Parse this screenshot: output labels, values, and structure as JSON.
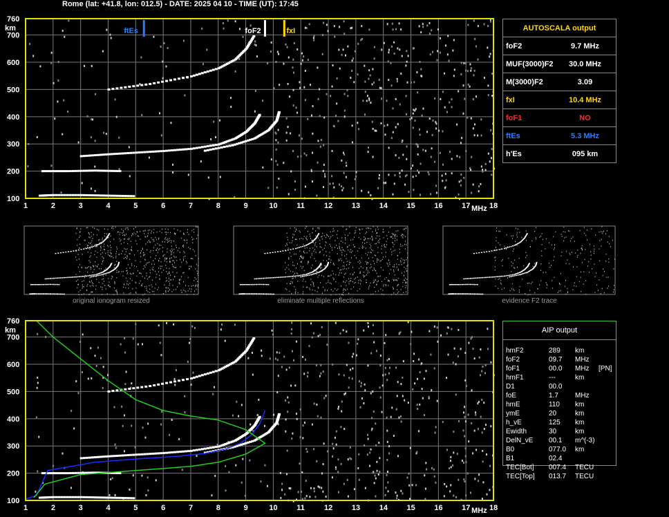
{
  "header": {
    "text": "Rome (lat: +41.8, lon: 012.5) - DATE: 2025 04 10 - TIME (UT): 17:45"
  },
  "colors": {
    "grid": "#7a7a7a",
    "frame": "#e4e000",
    "esblue": "#2a7bff",
    "fxlyellow": "#ffd800",
    "red": "#ff2a2a",
    "green": "#1fd01f",
    "profile": "#1a2cff",
    "panelborder": "#3fbf3f"
  },
  "autoscala": {
    "title": "AUTOSCALA output",
    "rows": [
      {
        "label": "foF2",
        "value": "9.7 MHz",
        "color": "#ffffff"
      },
      {
        "label": "MUF(3000)F2",
        "value": "30.0 MHz",
        "color": "#ffffff"
      },
      {
        "label": "M(3000)F2",
        "value": "3.09",
        "color": "#ffffff"
      },
      {
        "label": "fxI",
        "value": "10.4 MHz",
        "color": "#ffd800"
      },
      {
        "label": "foF1",
        "value": "NO",
        "color": "#ff2a2a"
      },
      {
        "label": "ftEs",
        "value": "5.3 MHz",
        "color": "#2a7bff"
      },
      {
        "label": "h'Es",
        "value": "095     km",
        "color": "#ffffff"
      }
    ]
  },
  "aip": {
    "title": "AIP output",
    "rows": [
      {
        "name": "hmF2",
        "value": "289",
        "unit": "km",
        "extra": ""
      },
      {
        "name": "foF2",
        "value": "09.7",
        "unit": "MHz",
        "extra": ""
      },
      {
        "name": "foF1",
        "value": "00.0",
        "unit": "MHz",
        "extra": "[PN]"
      },
      {
        "name": "hmF1",
        "value": "---",
        "unit": "km",
        "extra": ""
      },
      {
        "name": "D1",
        "value": "00.0",
        "unit": "",
        "extra": ""
      },
      {
        "name": "foE",
        "value": "1.7",
        "unit": "MHz",
        "extra": ""
      },
      {
        "name": "hmE",
        "value": "110",
        "unit": "km",
        "extra": ""
      },
      {
        "name": "ymE",
        "value": "20",
        "unit": "km",
        "extra": ""
      },
      {
        "name": "h_vE",
        "value": "125",
        "unit": "km",
        "extra": ""
      },
      {
        "name": "Ewidth",
        "value": "30",
        "unit": "km",
        "extra": ""
      },
      {
        "name": "DelN_vE",
        "value": "00.1",
        "unit": "m^(-3)",
        "extra": ""
      },
      {
        "name": "B0",
        "value": "077.0",
        "unit": "km",
        "extra": ""
      },
      {
        "name": "B1",
        "value": "02.4",
        "unit": "",
        "extra": ""
      },
      {
        "name": "TEC[Bot]",
        "value": "007.4",
        "unit": "TECU",
        "extra": ""
      },
      {
        "name": "TEC[Top]",
        "value": "013.7",
        "unit": "TECU",
        "extra": ""
      }
    ]
  },
  "captions": [
    "original ionogram resized",
    "eliminate multiple reflections",
    "evidence F2 trace"
  ],
  "chart_data": [
    {
      "type": "scatter",
      "title": "",
      "xlabel": "MHz",
      "ylabel": "km",
      "xlim": [
        1,
        18
      ],
      "ylim": [
        100,
        760
      ],
      "x_ticks": [
        "1",
        "2",
        "3",
        "4",
        "5",
        "6",
        "7",
        "8",
        "9",
        "10",
        "11",
        "12",
        "13",
        "14",
        "15",
        "16",
        "17",
        "18"
      ],
      "y_ticks": [
        "100",
        "200",
        "300",
        "400",
        "500",
        "600",
        "700",
        "760"
      ],
      "markers": [
        {
          "label": "ftEs",
          "freq": 5.3,
          "color": "#2a7bff"
        },
        {
          "label": "foF2",
          "freq": 9.7,
          "color": "#ffffff"
        },
        {
          "label": "fxI",
          "freq": 10.4,
          "color": "#ffd800"
        }
      ],
      "traces": [
        {
          "name": "F2 o-trace",
          "points": [
            [
              3.0,
              255
            ],
            [
              4,
              262
            ],
            [
              5,
              268
            ],
            [
              6,
              274
            ],
            [
              7,
              282
            ],
            [
              8,
              298
            ],
            [
              8.6,
              320
            ],
            [
              9.0,
              345
            ],
            [
              9.3,
              375
            ],
            [
              9.5,
              410
            ]
          ]
        },
        {
          "name": "F2 x-trace",
          "points": [
            [
              7.5,
              275
            ],
            [
              8.5,
              295
            ],
            [
              9.3,
              320
            ],
            [
              9.8,
              350
            ],
            [
              10.1,
              385
            ],
            [
              10.2,
              420
            ]
          ]
        },
        {
          "name": "F2 2nd hop",
          "points": [
            [
              4.0,
              500
            ],
            [
              5.5,
              520
            ],
            [
              7,
              548
            ],
            [
              8,
              578
            ],
            [
              8.6,
              610
            ],
            [
              9.0,
              650
            ],
            [
              9.3,
              700
            ]
          ]
        },
        {
          "name": "Es",
          "points": [
            [
              1.5,
              110
            ],
            [
              2,
              112
            ],
            [
              3,
              112
            ],
            [
              4,
              110
            ],
            [
              5,
              108
            ]
          ]
        },
        {
          "name": "Es 2nd",
          "points": [
            [
              1.6,
              200
            ],
            [
              2.5,
              200
            ],
            [
              3.5,
              202
            ],
            [
              4.5,
              200
            ]
          ]
        }
      ]
    },
    {
      "type": "line",
      "title": "",
      "xlabel": "MHz",
      "ylabel": "km",
      "xlim": [
        1,
        18
      ],
      "ylim": [
        100,
        760
      ],
      "x_ticks": [
        "1",
        "2",
        "3",
        "4",
        "5",
        "6",
        "7",
        "8",
        "9",
        "10",
        "11",
        "12",
        "13",
        "14",
        "15",
        "16",
        "17",
        "18"
      ],
      "y_ticks": [
        "100",
        "200",
        "300",
        "400",
        "500",
        "600",
        "700",
        "760"
      ],
      "series": [
        {
          "values": [
            [
              1.0,
              105
            ],
            [
              1.4,
              118
            ],
            [
              1.8,
              210
            ],
            [
              2.5,
              222
            ],
            [
              3.5,
              240
            ],
            [
              5,
              252
            ],
            [
              6.5,
              262
            ],
            [
              7.5,
              272
            ],
            [
              8.3,
              290
            ],
            [
              8.8,
              310
            ],
            [
              9.2,
              340
            ],
            [
              9.5,
              380
            ],
            [
              9.7,
              430
            ]
          ],
          "color": "#1a2cff"
        },
        {
          "values": [
            [
              1.4,
              760
            ],
            [
              2,
              700
            ],
            [
              3,
              620
            ],
            [
              4,
              540
            ],
            [
              5,
              470
            ],
            [
              6,
              430
            ],
            [
              7,
              410
            ],
            [
              8,
              395
            ],
            [
              9,
              360
            ],
            [
              9.7,
              310
            ],
            [
              9,
              270
            ],
            [
              8,
              240
            ],
            [
              7,
              225
            ],
            [
              5,
              210
            ],
            [
              3,
              195
            ],
            [
              1.7,
              160
            ],
            [
              1.3,
              110
            ]
          ],
          "color": "#1fd01f"
        }
      ]
    }
  ]
}
